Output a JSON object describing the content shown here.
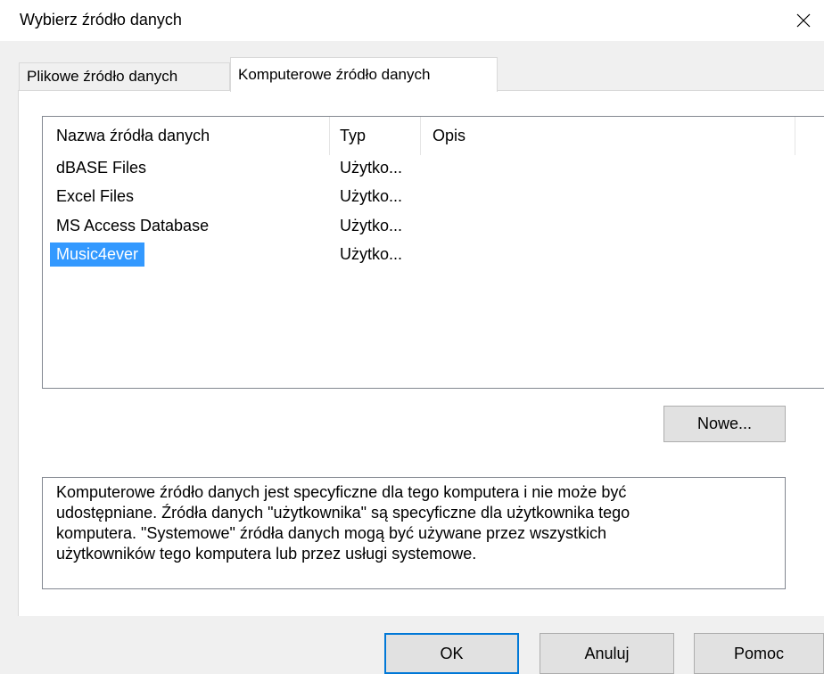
{
  "dialog": {
    "title": "Wybierz źródło danych",
    "close_icon": "close-icon"
  },
  "tabs": [
    {
      "label": "Plikowe źródło danych",
      "active": false
    },
    {
      "label": "Komputerowe źródło danych",
      "active": true
    }
  ],
  "list": {
    "columns": [
      "Nazwa źródła danych",
      "Typ",
      "Opis"
    ],
    "rows": [
      {
        "name": "dBASE Files",
        "type": "Użytko...",
        "desc": ""
      },
      {
        "name": "Excel Files",
        "type": "Użytko...",
        "desc": ""
      },
      {
        "name": "MS Access Database",
        "type": "Użytko...",
        "desc": ""
      },
      {
        "name": "Music4ever",
        "type": "Użytko...",
        "desc": "",
        "selected": true
      }
    ]
  },
  "buttons": {
    "new_label": "Nowe...",
    "ok_label": "OK",
    "cancel_label": "Anuluj",
    "help_label": "Pomoc"
  },
  "description": {
    "lines": [
      "Komputerowe źródło danych jest specyficzne dla tego komputera i nie może być",
      "udostępniane. Źródła danych \"użytkownika\" są specyficzne dla użytkownika tego",
      "komputera. \"Systemowe\" źródła danych mogą być używane przez wszystkich",
      "użytkowników tego komputera lub przez usługi systemowe."
    ]
  },
  "colors": {
    "selection": "#3399ff",
    "default_button_border": "#0078d7",
    "dialog_background": "#f0f0f0"
  }
}
